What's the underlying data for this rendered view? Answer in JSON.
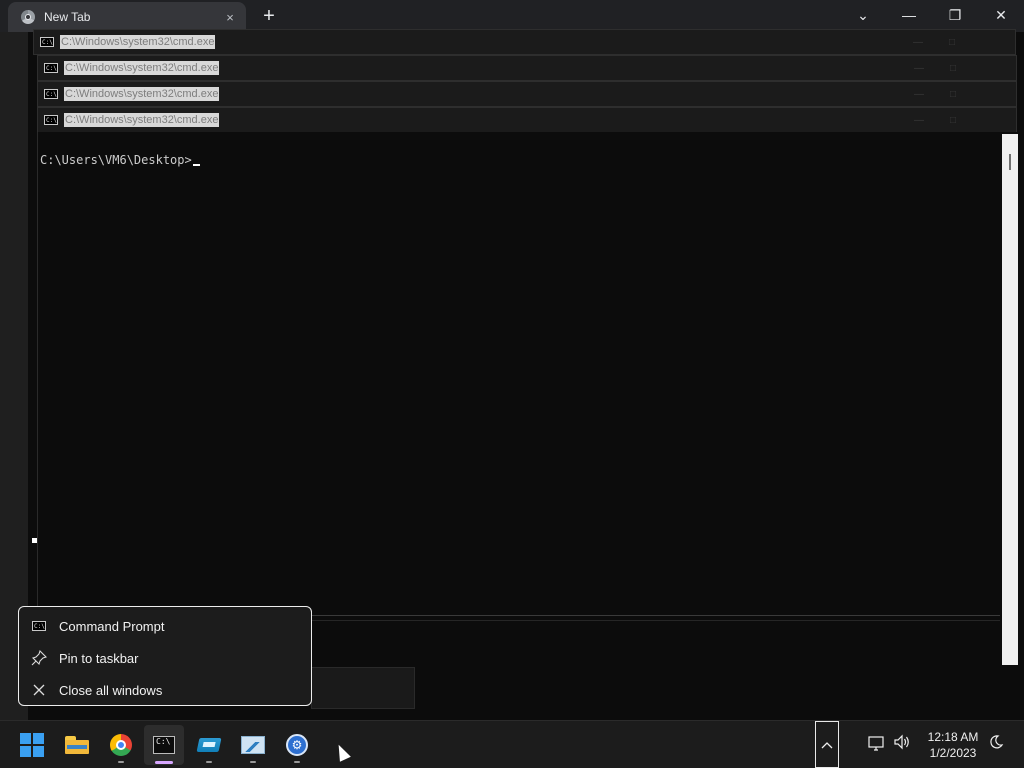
{
  "browser": {
    "tab_title": "New Tab",
    "tab_close": "×",
    "new_tab": "+",
    "tab_search": "⌄",
    "minimize": "—",
    "maximize": "❐",
    "close": "✕"
  },
  "cmd_windows": [
    {
      "title": "C:\\Windows\\system32\\cmd.exe"
    },
    {
      "title": "C:\\Windows\\system32\\cmd.exe"
    },
    {
      "title": "C:\\Windows\\system32\\cmd.exe"
    },
    {
      "title": "C:\\Windows\\system32\\cmd.exe"
    }
  ],
  "console": {
    "prompt": "C:\\Users\\VM6\\Desktop>",
    "icon_text": "C:\\"
  },
  "jumplist": {
    "items": [
      {
        "label": "Command Prompt",
        "icon": "cmd-icon"
      },
      {
        "label": "Pin to taskbar",
        "icon": "pin-icon"
      },
      {
        "label": "Close all windows",
        "icon": "close-icon"
      }
    ]
  },
  "taskbar": {
    "apps": [
      "start",
      "file-explorer",
      "chrome",
      "command-prompt",
      "disk-app",
      "performance-monitor",
      "settings-app"
    ]
  },
  "tray": {
    "time": "12:18 AM",
    "date": "1/2/2023"
  }
}
